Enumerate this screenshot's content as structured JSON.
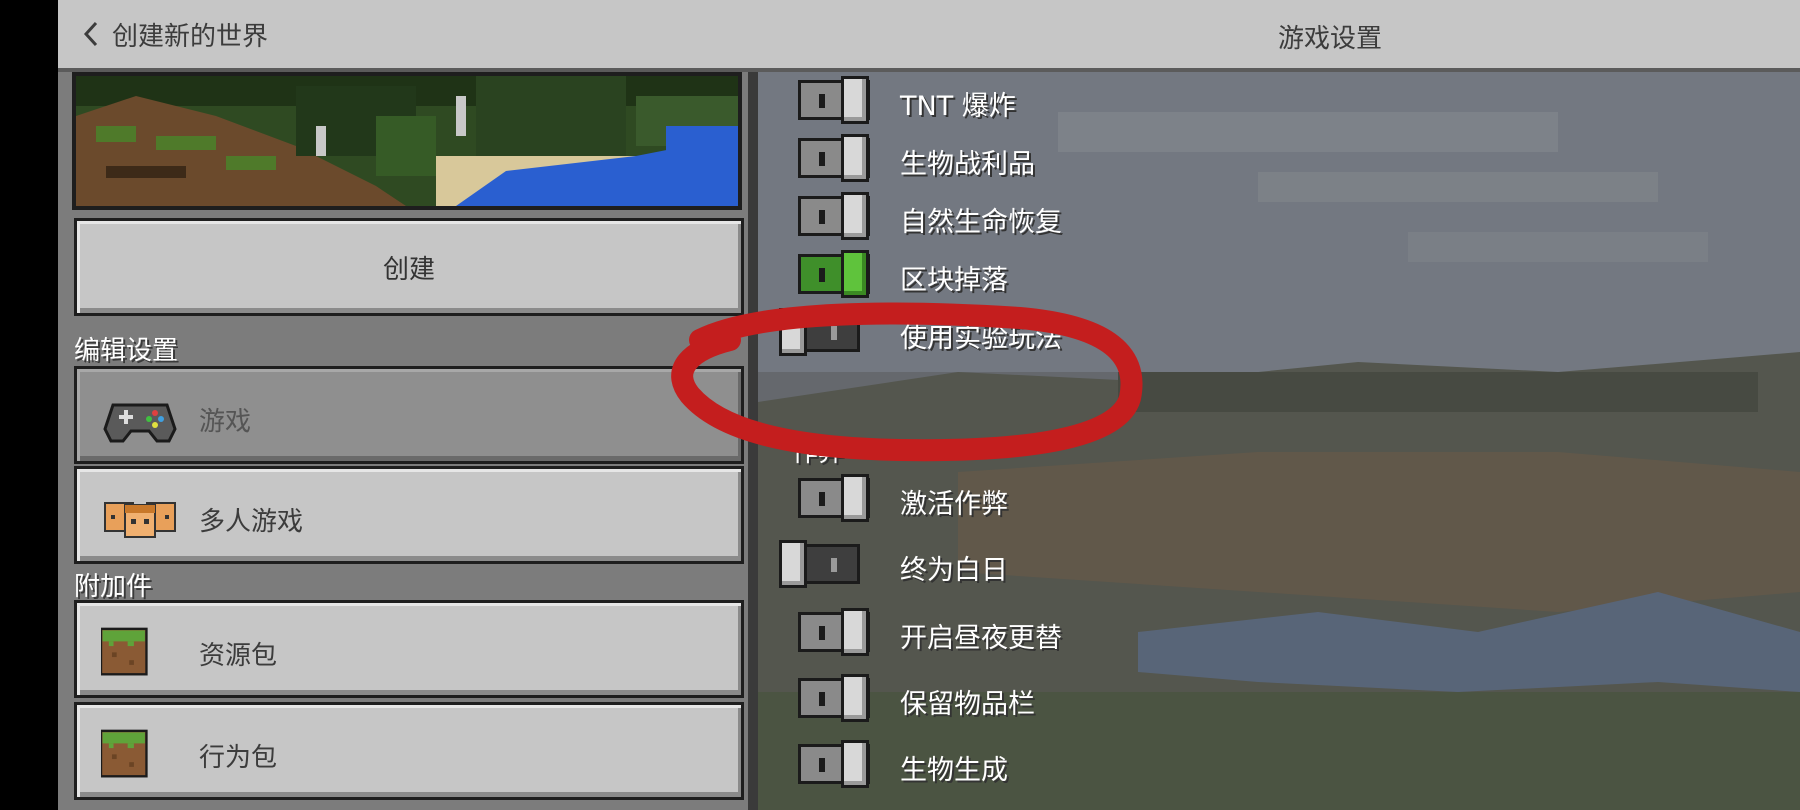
{
  "header": {
    "back_label": "创建新的世界",
    "title": "游戏设置"
  },
  "left": {
    "create_label": "创建",
    "edit_settings_label": "编辑设置",
    "menu_items": [
      {
        "label": "游戏",
        "icon": "controller-icon",
        "active": true
      },
      {
        "label": "多人游戏",
        "icon": "players-icon",
        "active": false
      }
    ],
    "addons_label": "附加件",
    "addon_items": [
      {
        "label": "资源包",
        "icon": "grass-block-icon"
      },
      {
        "label": "行为包",
        "icon": "grass-block-icon"
      }
    ]
  },
  "settings": [
    {
      "label": "TNT 爆炸",
      "state": "on"
    },
    {
      "label": "生物战利品",
      "state": "on"
    },
    {
      "label": "自然生命恢复",
      "state": "on"
    },
    {
      "label": "区块掉落",
      "state": "green"
    },
    {
      "label": "使用实验玩法",
      "state": "off"
    },
    {
      "label": "激活作弊",
      "state": "on"
    },
    {
      "label": "终为白日",
      "state": "off"
    },
    {
      "label": "开启昼夜更替",
      "state": "on"
    },
    {
      "label": "保留物品栏",
      "state": "on"
    },
    {
      "label": "生物生成",
      "state": "on"
    }
  ],
  "cheats_section_label": "作弊",
  "colors": {
    "header_bg": "#c6c6c6",
    "button_bg": "#c6c6c6",
    "annotation": "#c41e1e",
    "toggle_green": "#3f8f2a"
  }
}
